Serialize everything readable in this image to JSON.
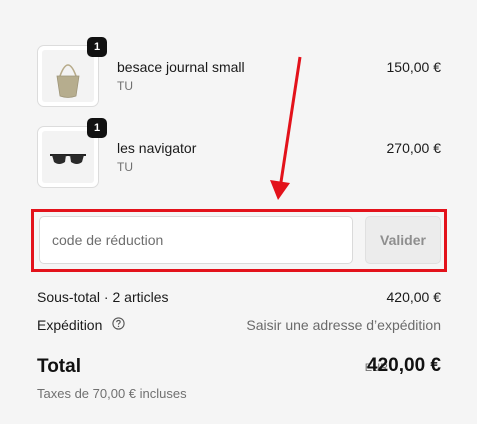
{
  "cart": {
    "items": [
      {
        "name": "besace journal small",
        "variant": "TU",
        "price": "150,00 €",
        "quantity": "1",
        "image": "bag-image"
      },
      {
        "name": "les navigator",
        "variant": "TU",
        "price": "270,00 €",
        "quantity": "1",
        "image": "sunglasses-image"
      }
    ]
  },
  "discount": {
    "placeholder": "code de réduction",
    "value": "",
    "apply_label": "Valider"
  },
  "summary": {
    "subtotal_label": "Sous-total · 2 articles",
    "subtotal_value": "420,00 €",
    "shipping_label": "Expédition",
    "shipping_value": "Saisir une adresse d’expédition",
    "total_label": "Total",
    "currency": "EUR",
    "total_value": "420,00 €",
    "taxes_note": "Taxes de 70,00 € incluses"
  },
  "colors": {
    "highlight": "#e3121b",
    "badge": "#111111",
    "background": "#f5f5f5"
  }
}
